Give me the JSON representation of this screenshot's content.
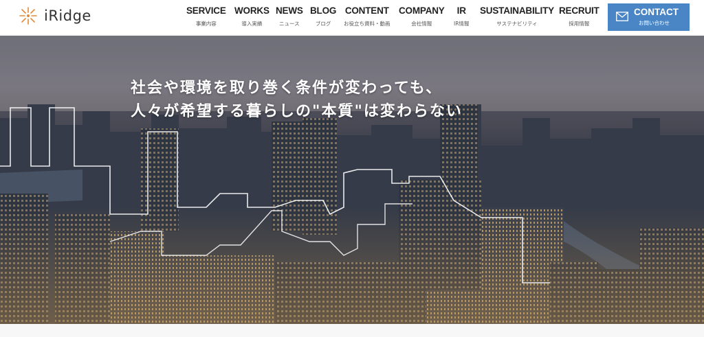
{
  "brand": {
    "name": "iRidge",
    "accent": "#e08a3a"
  },
  "nav": [
    {
      "en": "SERVICE",
      "ja": "事業内容"
    },
    {
      "en": "WORKS",
      "ja": "導入実績"
    },
    {
      "en": "NEWS",
      "ja": "ニュース"
    },
    {
      "en": "BLOG",
      "ja": "ブログ"
    },
    {
      "en": "CONTENT",
      "ja": "お役立ち資料・動画"
    },
    {
      "en": "COMPANY",
      "ja": "会社情報"
    },
    {
      "en": "IR",
      "ja": "IR情報"
    },
    {
      "en": "SUSTAINABILITY",
      "ja": "サステナビリティ"
    },
    {
      "en": "RECRUIT",
      "ja": "採用情報"
    }
  ],
  "contact": {
    "en": "CONTACT",
    "ja": "お問い合わせ",
    "color": "#4a86c5",
    "icon": "mail-icon"
  },
  "hero": {
    "line1": "社会や環境を取り巻く条件が変わっても、",
    "line2": "人々が希望する暮らしの\"本質\"は変わらない"
  }
}
